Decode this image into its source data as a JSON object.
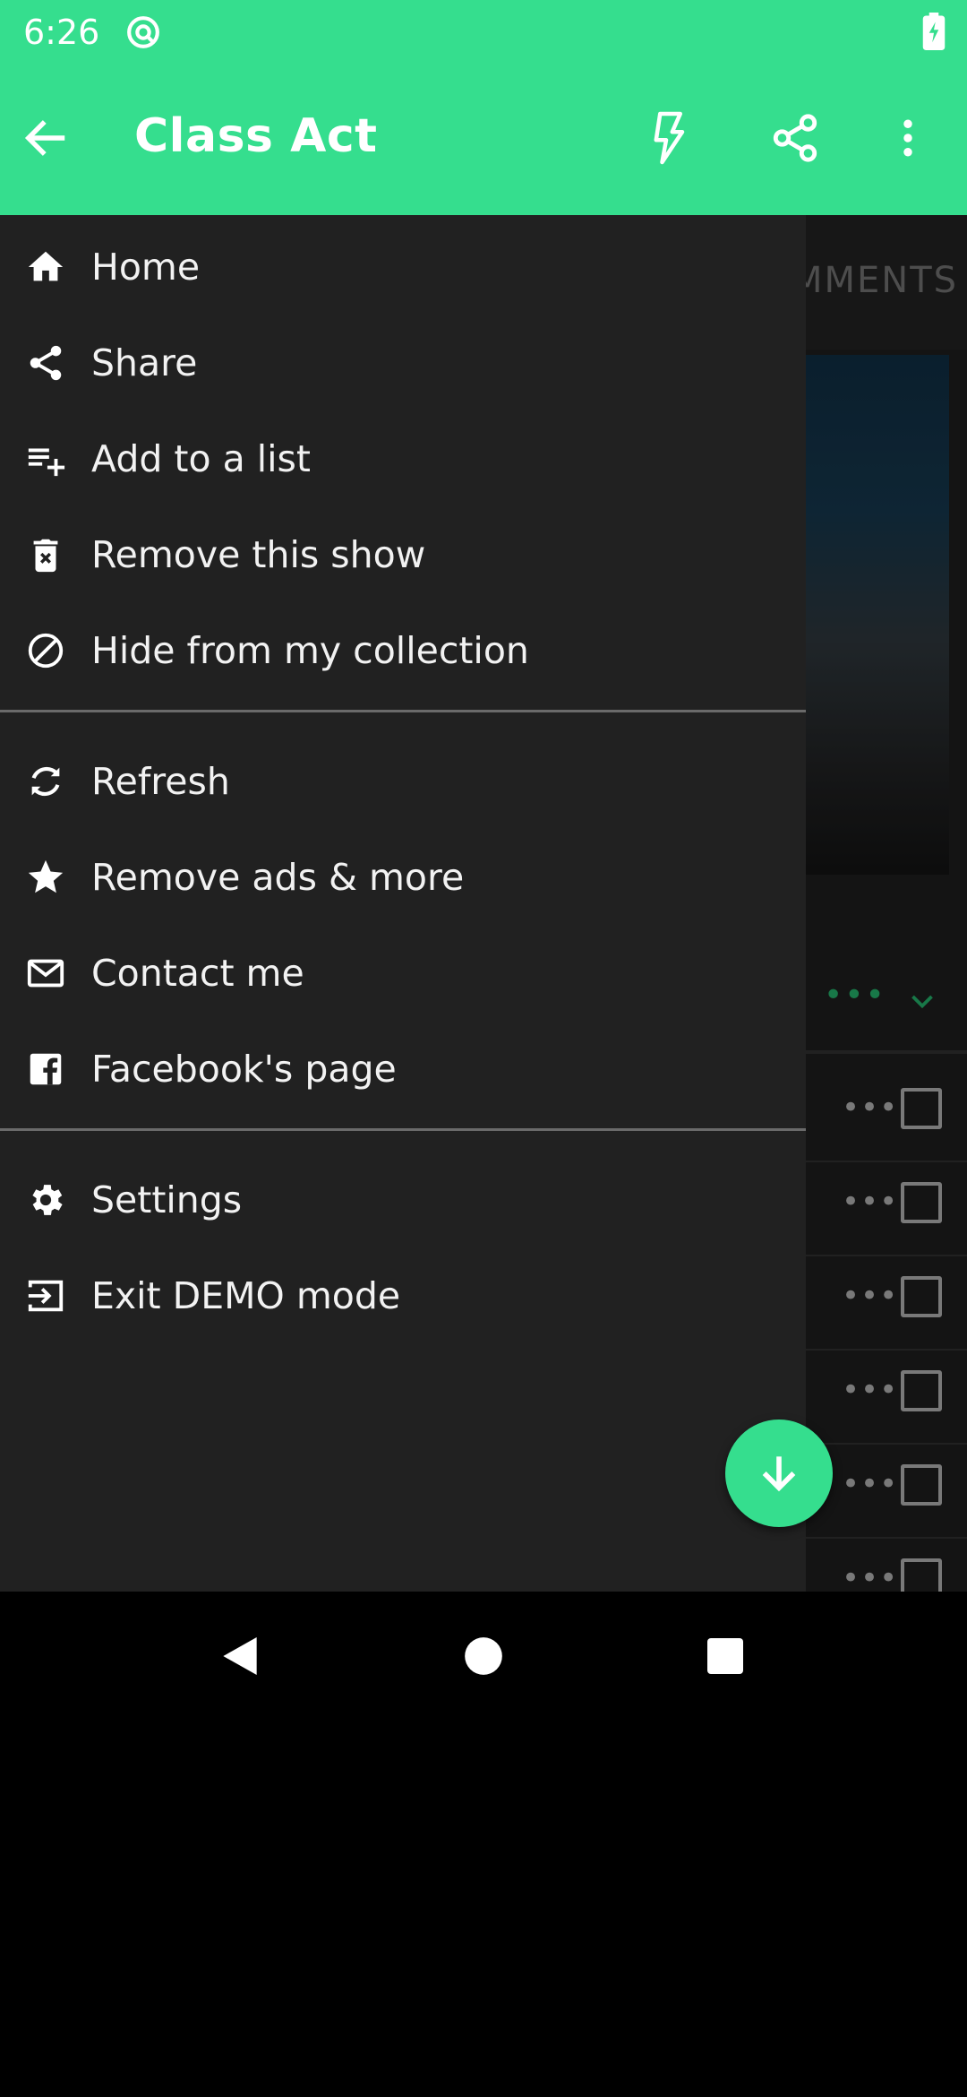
{
  "status_bar": {
    "time": "6:26",
    "app_icon": "notification-app-icon",
    "battery_icon": "battery-charging-icon"
  },
  "toolbar": {
    "title": "Class Act",
    "back_icon": "arrow-back-icon",
    "actions": [
      "flash-icon",
      "share-icon",
      "more-vert-icon"
    ]
  },
  "background": {
    "tab_label": "MMENTS",
    "episode_rows": 6
  },
  "drawer": {
    "section1": [
      {
        "label": "Home",
        "icon": "home-icon"
      },
      {
        "label": "Share",
        "icon": "share-icon"
      },
      {
        "label": "Add to a list",
        "icon": "playlist-add-icon"
      },
      {
        "label": "Remove this show",
        "icon": "delete-icon"
      },
      {
        "label": "Hide from my collection",
        "icon": "block-icon"
      }
    ],
    "section2": [
      {
        "label": "Refresh",
        "icon": "refresh-icon"
      },
      {
        "label": "Remove ads & more",
        "icon": "star-icon"
      },
      {
        "label": "Contact me",
        "icon": "mail-icon"
      },
      {
        "label": "Facebook's page",
        "icon": "facebook-icon"
      }
    ],
    "section3": [
      {
        "label": "Settings",
        "icon": "settings-gear-icon"
      },
      {
        "label": "Exit DEMO mode",
        "icon": "exit-icon"
      }
    ]
  },
  "fab": {
    "icon": "arrow-down-icon"
  },
  "nav_bar": {
    "buttons": [
      "back-triangle-icon",
      "home-circle-icon",
      "recents-square-icon"
    ]
  },
  "colors": {
    "accent": "#35de8e",
    "drawer_bg": "#212121",
    "divider": "#6a6a6a"
  }
}
